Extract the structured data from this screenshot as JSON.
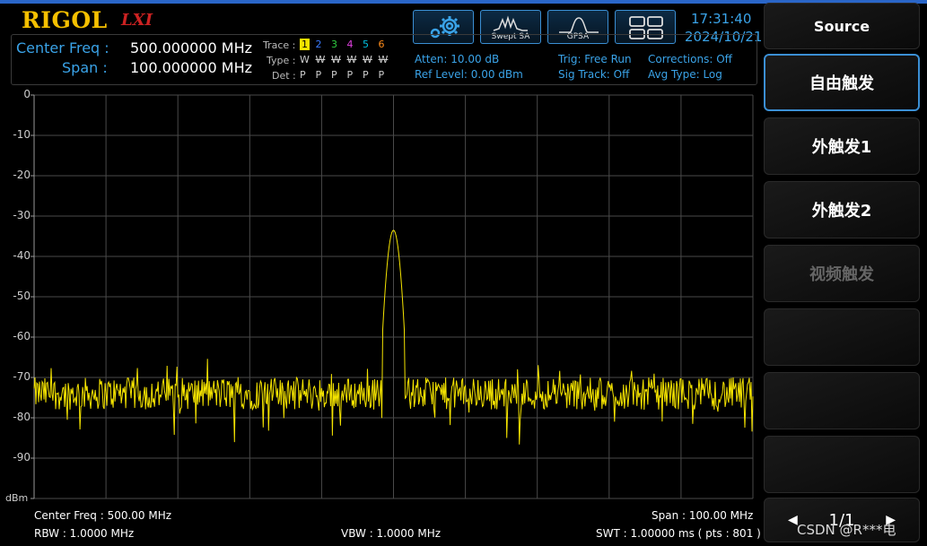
{
  "brand": "RIGOL",
  "brand_sub": "LXI",
  "modes": [
    {
      "label": "",
      "icon": "settings-gears-icon"
    },
    {
      "label": "Swept SA",
      "icon": "swept-sa-icon"
    },
    {
      "label": "GPSA",
      "icon": "gpsa-icon"
    },
    {
      "label": "",
      "icon": "window-layout-icon"
    }
  ],
  "clock": {
    "time": "17:31:40",
    "date": "2024/10/21"
  },
  "freq": {
    "center_label": "Center Freq :",
    "center_value": "500.000000 MHz",
    "span_label": "Span :",
    "span_value": "100.000000 MHz"
  },
  "trace": {
    "trace_label": "Trace :",
    "type_label": "Type :",
    "det_label": "Det :",
    "numbers": [
      "1",
      "2",
      "3",
      "4",
      "5",
      "6"
    ],
    "colors": [
      "#f5e400",
      "#3a7bff",
      "#2ecc40",
      "#e040e0",
      "#00c0e0",
      "#ff8c1a"
    ],
    "types": [
      "W",
      "W",
      "W",
      "W",
      "W",
      "W"
    ],
    "dets": [
      "P",
      "P",
      "P",
      "P",
      "P",
      "P"
    ]
  },
  "status": {
    "atten": "Atten: 10.00 dB",
    "ref_level": "Ref Level: 0.00 dBm",
    "trig": "Trig: Free Run",
    "sig_track": "Sig Track: Off",
    "corrections": "Corrections: Off",
    "avg_type": "Avg Type: Log"
  },
  "y_axis": {
    "unit": "dBm",
    "ticks": [
      "0",
      "-10",
      "-20",
      "-30",
      "-40",
      "-50",
      "-60",
      "-70",
      "-80",
      "-90"
    ]
  },
  "chart_data": {
    "type": "line",
    "x_range_mhz": [
      450,
      550
    ],
    "ylim": [
      -100,
      0
    ],
    "yticks": [
      0,
      -10,
      -20,
      -30,
      -40,
      -50,
      -60,
      -70,
      -80,
      -90
    ],
    "ylabel": "dBm",
    "grid": true,
    "series": [
      {
        "color": "#f5e400",
        "peak": {
          "x_mhz": 500.0,
          "y_dbm": -33.5
        },
        "noise_floor_dbm": -74
      }
    ]
  },
  "footer": {
    "center_freq": "Center Freq : 500.00 MHz",
    "span": "Span : 100.00 MHz",
    "rbw": "RBW : 1.0000 MHz",
    "vbw": "VBW : 1.0000 MHz",
    "swt": "SWT : 1.00000 ms ( pts : 801 )"
  },
  "softkeys": {
    "title": "Source",
    "items": [
      {
        "label": "自由触发",
        "state": "active"
      },
      {
        "label": "外触发1",
        "state": "normal"
      },
      {
        "label": "外触发2",
        "state": "normal"
      },
      {
        "label": "视频触发",
        "state": "disabled"
      },
      {
        "label": "",
        "state": "normal"
      },
      {
        "label": "",
        "state": "normal"
      },
      {
        "label": "",
        "state": "normal"
      }
    ],
    "page": "1/1"
  },
  "watermark": "CSDN @R***电"
}
